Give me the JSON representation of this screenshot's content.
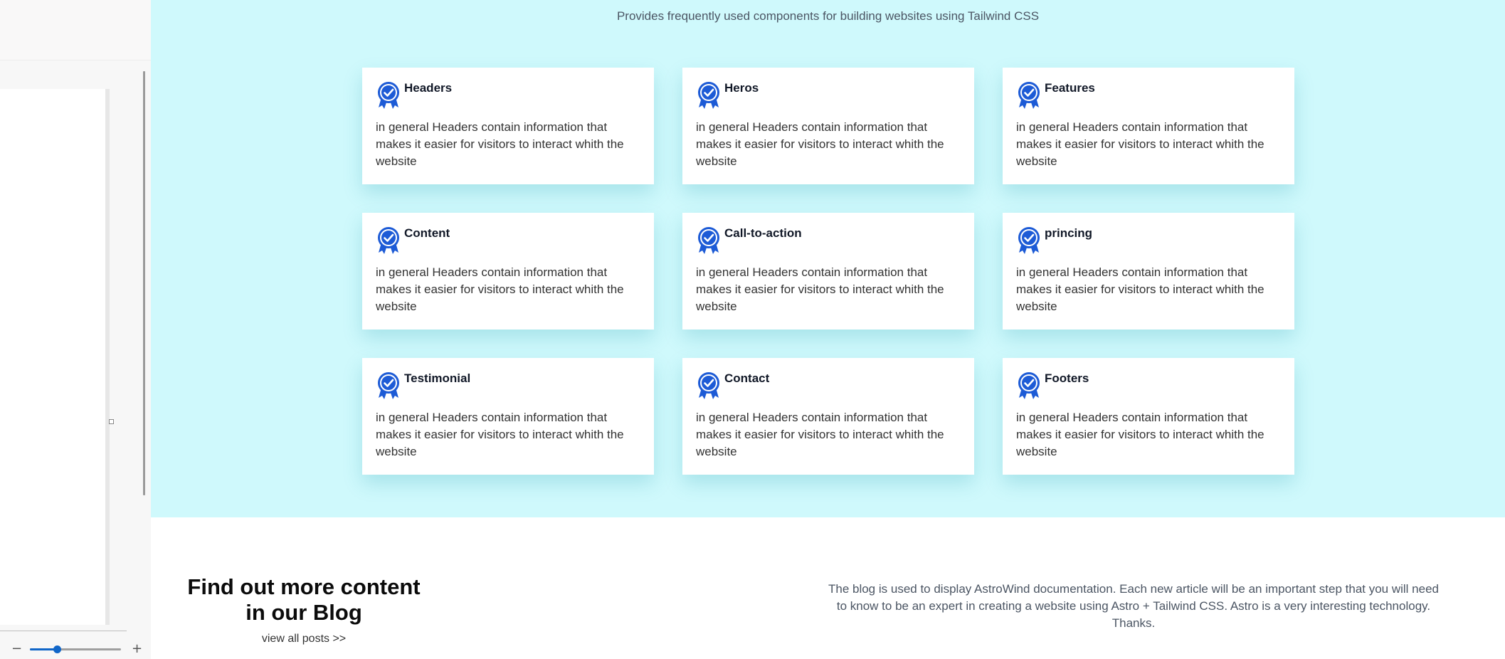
{
  "editor_panel": {
    "zoom": {
      "minus_label": "−",
      "plus_label": "+",
      "level": 0.3
    }
  },
  "features_section": {
    "subtitle": "Provides frequently used components for building websites using Tailwind CSS",
    "cards": [
      {
        "title": "Headers",
        "text": "in general Headers contain information that makes it easier for visitors to interact whith the website",
        "icon": "award-check-icon"
      },
      {
        "title": "Heros",
        "text": "in general Headers contain information that makes it easier for visitors to interact whith the website",
        "icon": "award-check-icon"
      },
      {
        "title": "Features",
        "text": "in general Headers contain information that makes it easier for visitors to interact whith the website",
        "icon": "award-check-icon"
      },
      {
        "title": "Content",
        "text": "in general Headers contain information that makes it easier for visitors to interact whith the website",
        "icon": "award-check-icon"
      },
      {
        "title": "Call-to-action",
        "text": "in general Headers contain information that makes it easier for visitors to interact whith the website",
        "icon": "award-check-icon"
      },
      {
        "title": "princing",
        "text": "in general Headers contain information that makes it easier for visitors to interact whith the website",
        "icon": "award-check-icon"
      },
      {
        "title": "Testimonial",
        "text": "in general Headers contain information that makes it easier for visitors to interact whith the website",
        "icon": "award-check-icon"
      },
      {
        "title": "Contact",
        "text": "in general Headers contain information that makes it easier for visitors to interact whith the website",
        "icon": "award-check-icon"
      },
      {
        "title": "Footers",
        "text": "in general Headers contain information that makes it easier for visitors to interact whith the website",
        "icon": "award-check-icon"
      }
    ]
  },
  "blog_section": {
    "title": "Find out more content in our Blog",
    "link_label": "view all posts >>",
    "description": "The blog is used to display AstroWind documentation. Each new article will be an important step that you will need to know to be an expert in creating a website using Astro + Tailwind CSS. Astro is a very interesting technology. Thanks."
  },
  "colors": {
    "section_background": "#cff9fc",
    "icon_blue": "#1d5bd6",
    "accent": "#1166c8"
  }
}
